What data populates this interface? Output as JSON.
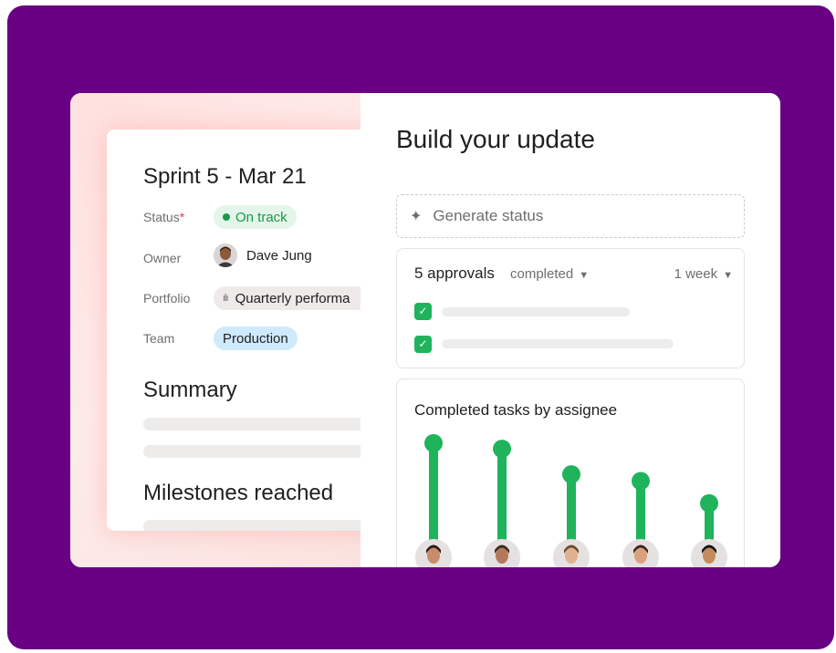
{
  "project": {
    "title": "Sprint 5 - Mar 21",
    "status_label": "Status",
    "status_required": "*",
    "status_value": "On track",
    "owner_label": "Owner",
    "owner_name": "Dave Jung",
    "portfolio_label": "Portfolio",
    "portfolio_value": "Quarterly performa",
    "team_label": "Team",
    "team_value": "Production",
    "summary_heading": "Summary",
    "milestones_heading": "Milestones reached"
  },
  "update": {
    "title": "Build your update",
    "generate_label": "Generate status",
    "approvals_count": "5 approvals",
    "approvals_filter": "completed",
    "period": "1 week"
  },
  "chart_data": {
    "type": "bar",
    "title": "Completed tasks by assignee",
    "categories": [
      "",
      "",
      "",
      "",
      ""
    ],
    "values": [
      100,
      95,
      72,
      66,
      46
    ],
    "ylim": [
      0,
      100
    ],
    "grid": false
  },
  "colors": {
    "background": "#690083",
    "accent_green": "#1fb35c",
    "status_green": "#1d9849",
    "team_blue": "#cfeafc"
  },
  "icons": {
    "status": "dot-icon",
    "generate": "sparkle-icon",
    "dropdown": "chevron-down-icon",
    "checkbox": "check-icon",
    "portfolio": "bar-chart-icon"
  }
}
